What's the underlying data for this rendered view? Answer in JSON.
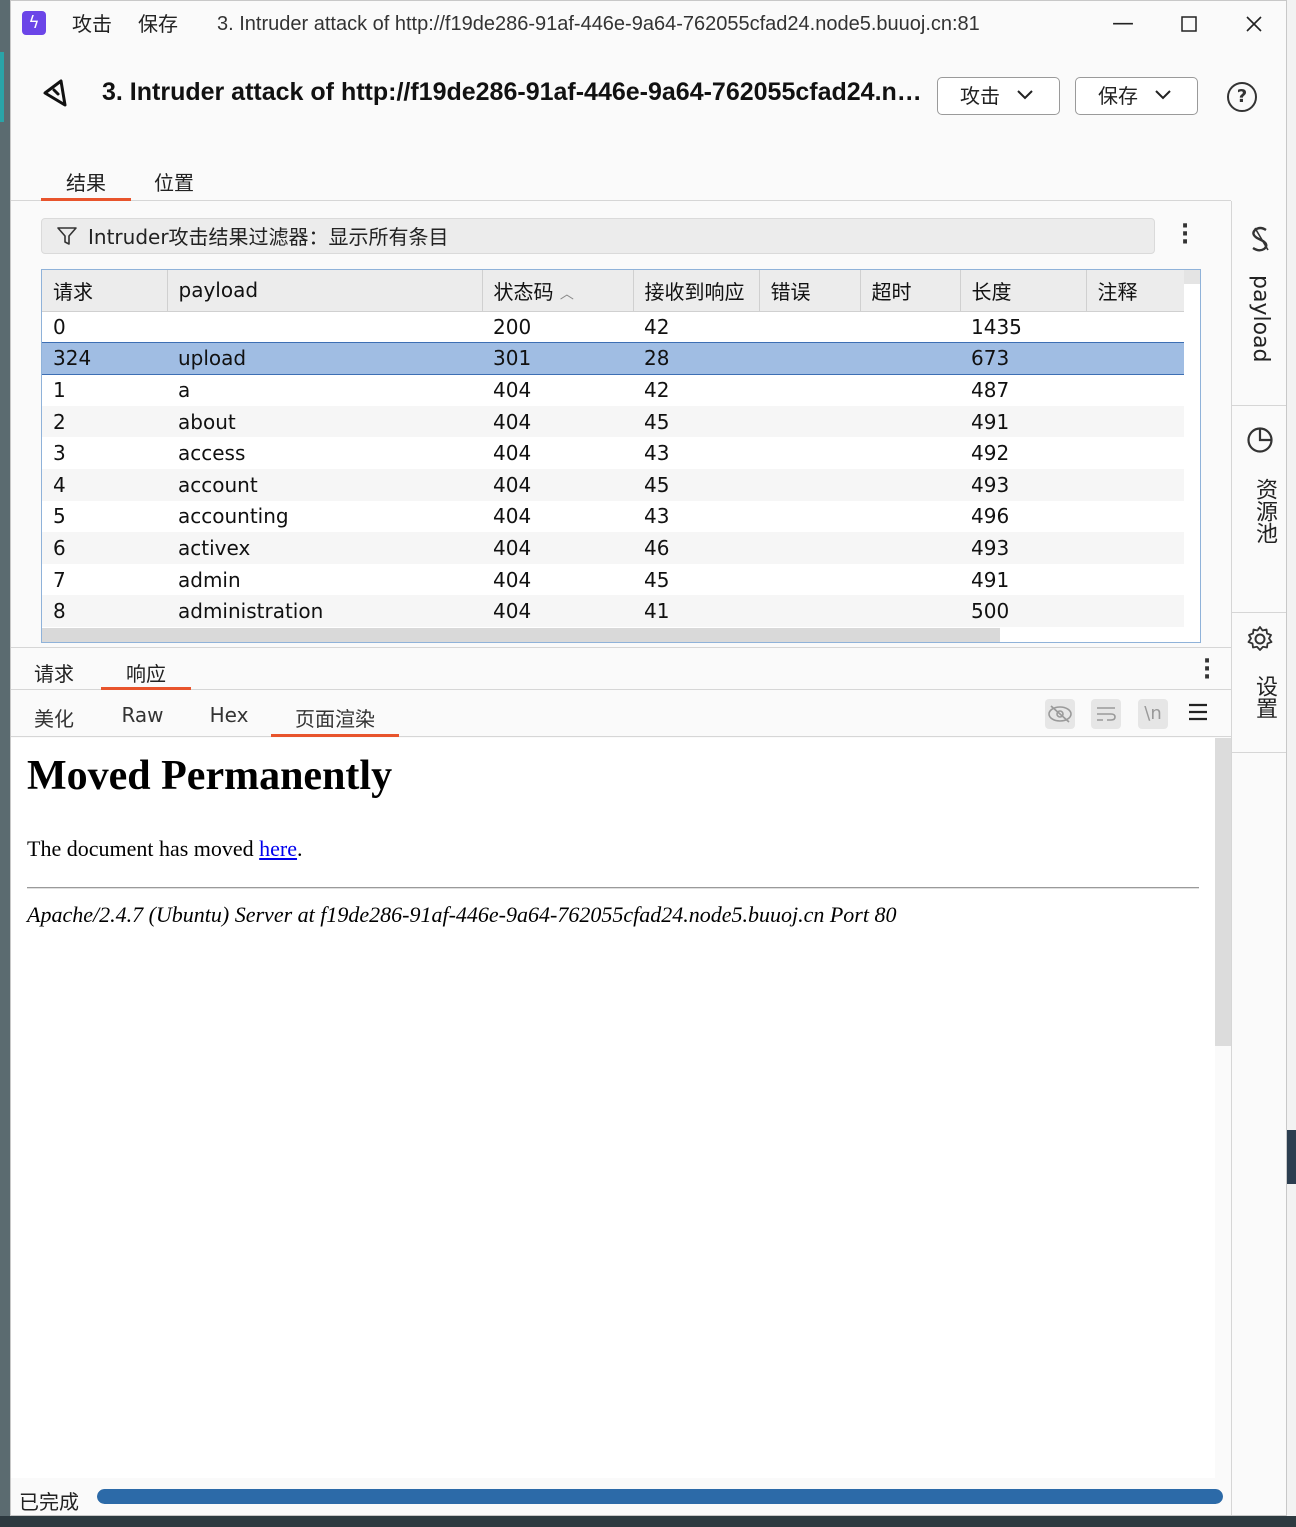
{
  "titlebar": {
    "menu_attack": "攻击",
    "menu_save": "保存",
    "title": "3. Intruder attack of http://f19de286-91af-446e-9a64-762055cfad24.node5.buuoj.cn:81",
    "minimize_icon": "minimize-icon",
    "maximize_icon": "maximize-icon",
    "close_icon": "close-icon"
  },
  "header": {
    "title": "3. Intruder attack of http://f19de286-91af-446e-9a64-762055cfad24.node5.buuoj.cn:81",
    "attack_button": "攻击",
    "save_button": "保存"
  },
  "tabs": [
    {
      "label": "结果",
      "active": true
    },
    {
      "label": "位置",
      "active": false
    }
  ],
  "filter": {
    "text": "Intruder攻击结果过滤器：显示所有条目"
  },
  "table": {
    "columns": [
      "请求",
      "payload",
      "状态码",
      "接收到响应",
      "错误",
      "超时",
      "长度",
      "注释"
    ],
    "sort_indicator": "^",
    "selected_row": 1,
    "rows": [
      {
        "request": "0",
        "payload": "",
        "status": "200",
        "received": "42",
        "error": "",
        "timeout": "",
        "length": "1435",
        "comment": ""
      },
      {
        "request": "324",
        "payload": "upload",
        "status": "301",
        "received": "28",
        "error": "",
        "timeout": "",
        "length": "673",
        "comment": ""
      },
      {
        "request": "1",
        "payload": "a",
        "status": "404",
        "received": "42",
        "error": "",
        "timeout": "",
        "length": "487",
        "comment": ""
      },
      {
        "request": "2",
        "payload": "about",
        "status": "404",
        "received": "45",
        "error": "",
        "timeout": "",
        "length": "491",
        "comment": ""
      },
      {
        "request": "3",
        "payload": "access",
        "status": "404",
        "received": "43",
        "error": "",
        "timeout": "",
        "length": "492",
        "comment": ""
      },
      {
        "request": "4",
        "payload": "account",
        "status": "404",
        "received": "45",
        "error": "",
        "timeout": "",
        "length": "493",
        "comment": ""
      },
      {
        "request": "5",
        "payload": "accounting",
        "status": "404",
        "received": "43",
        "error": "",
        "timeout": "",
        "length": "496",
        "comment": ""
      },
      {
        "request": "6",
        "payload": "activex",
        "status": "404",
        "received": "46",
        "error": "",
        "timeout": "",
        "length": "493",
        "comment": ""
      },
      {
        "request": "7",
        "payload": "admin",
        "status": "404",
        "received": "45",
        "error": "",
        "timeout": "",
        "length": "491",
        "comment": ""
      },
      {
        "request": "8",
        "payload": "administration",
        "status": "404",
        "received": "41",
        "error": "",
        "timeout": "",
        "length": "500",
        "comment": ""
      }
    ]
  },
  "detail_tabs": [
    {
      "label": "请求",
      "active": false
    },
    {
      "label": "响应",
      "active": true
    }
  ],
  "view_tabs": [
    {
      "label": "美化",
      "active": false
    },
    {
      "label": "Raw",
      "active": false
    },
    {
      "label": "Hex",
      "active": false
    },
    {
      "label": "页面渲染",
      "active": true
    }
  ],
  "view_tools": {
    "newline_label": "\\n"
  },
  "rendered_page": {
    "heading": "Moved Permanently",
    "text_before_link": "The document has moved ",
    "link": "here",
    "text_after_link": ".",
    "address": "Apache/2.4.7 (Ubuntu) Server at f19de286-91af-446e-9a64-762055cfad24.node5.buuoj.cn Port 80"
  },
  "sidebar": {
    "items": [
      {
        "label": "payload",
        "icon": "payload-s-icon"
      },
      {
        "label": "资源池",
        "icon": "pie-chart-icon"
      },
      {
        "label": "设置",
        "icon": "gear-icon"
      }
    ]
  },
  "status": {
    "text": "已完成",
    "progress": 1.0
  },
  "colors": {
    "accent": "#e8542c",
    "selection": "#a0bde3",
    "progress": "#2c6aa8",
    "app_icon": "#6b45e8"
  }
}
